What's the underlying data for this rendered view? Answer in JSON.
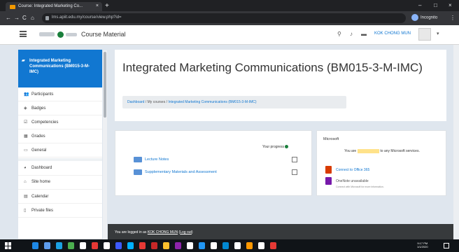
{
  "browser": {
    "tab_title": "Course: Integrated Marketing Co...",
    "tab_close": "×",
    "new_tab": "+",
    "url": "lms.apiit.edu.my/course/view.php?id=",
    "window_controls": [
      "–",
      "□",
      "×"
    ],
    "nav_buttons": [
      "←",
      "→",
      "C",
      "⌂"
    ],
    "profile_label": "Incognito",
    "menu_icon": "⋮"
  },
  "navbar": {
    "site_name": "Course Material",
    "username": "KOK CHONG MUN",
    "icons": [
      "search-icon",
      "bell-icon",
      "chat-icon"
    ]
  },
  "drawer": {
    "active_item": "Integrated Marketing Communications (BM015-3-M-IMC)",
    "items": [
      {
        "label": "Participants",
        "icon": "users-icon",
        "glyph": "👥"
      },
      {
        "label": "Badges",
        "icon": "badge-icon",
        "glyph": "◈"
      },
      {
        "label": "Competencies",
        "icon": "check-icon",
        "glyph": "☑"
      },
      {
        "label": "Grades",
        "icon": "table-icon",
        "glyph": "▦"
      },
      {
        "label": "General",
        "icon": "folder-icon",
        "glyph": "▭"
      }
    ],
    "items2": [
      {
        "label": "Dashboard",
        "icon": "dashboard-icon",
        "glyph": "◕"
      },
      {
        "label": "Site home",
        "icon": "home-icon",
        "glyph": "⌂"
      },
      {
        "label": "Calendar",
        "icon": "calendar-icon",
        "glyph": "▤"
      },
      {
        "label": "Private files",
        "icon": "file-icon",
        "glyph": "▯"
      }
    ]
  },
  "page": {
    "title": "Integrated Marketing Communications (BM015-3-M-IMC)",
    "breadcrumb": [
      "Dashboard",
      "My courses",
      "Integrated Marketing Communications (BM015-3-M-IMC)"
    ],
    "breadcrumb_sep": "/"
  },
  "course": {
    "progress_label": "Your progress",
    "activities": [
      {
        "label": "Lecture Notes",
        "completed": false
      },
      {
        "label": "Supplementary Materials and Assessment",
        "completed": false
      }
    ]
  },
  "microsoft": {
    "title": "Microsoft",
    "message_pre": "You are",
    "message_hl": "not connected",
    "message_post": "to any Microsoft services.",
    "links": [
      {
        "label": "Connect to Office 365",
        "icon": "office-icon"
      },
      {
        "label": "OneNote unavailable",
        "icon": "onenote-icon"
      }
    ],
    "sub_note": "Connect with Microsoft for more information."
  },
  "footer": {
    "text_pre": "You are logged in as",
    "user": "KOK CHONG MUN",
    "logout": "Log out"
  },
  "taskbar": {
    "clock_time": "9:17 PM",
    "clock_date": "1/1/2020",
    "app_colors": [
      "#1e88e5",
      "#5d9cec",
      "#1ba1e2",
      "#4caf50",
      "#ffffff",
      "#e53935",
      "#ffffff",
      "#3d5afe",
      "#00b0ff",
      "#e53935",
      "#c62828",
      "#fbc02d",
      "#8e24aa",
      "#ffffff",
      "#2196f3",
      "#ffffff",
      "#0288d1",
      "#ffffff",
      "#ff9800",
      "#ffffff",
      "#e53935"
    ]
  }
}
